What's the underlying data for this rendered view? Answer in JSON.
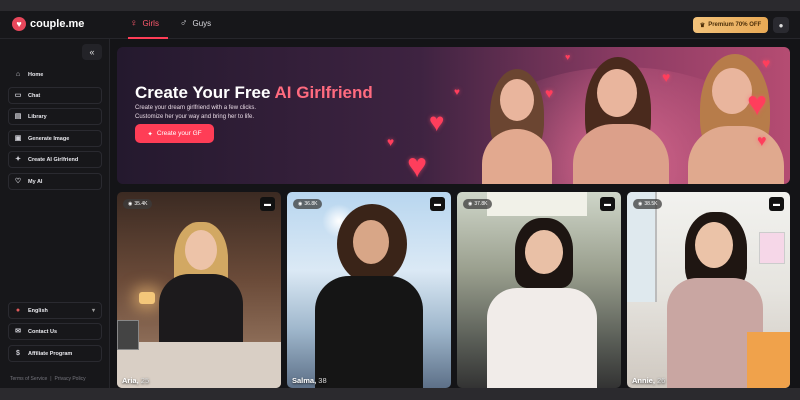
{
  "app": {
    "logo_text": "couple.me",
    "logo_icon": "heart-icon"
  },
  "header": {
    "tabs": [
      {
        "label": "Girls",
        "icon": "female-icon",
        "active": true
      },
      {
        "label": "Guys",
        "icon": "male-icon",
        "active": false
      }
    ],
    "premium_label": "Premium 70% OFF",
    "premium_icon": "crown-icon",
    "user_icon": "user-icon"
  },
  "sidebar": {
    "collapse_icon": "double-chevron-left-icon",
    "items": [
      {
        "label": "Home",
        "icon": "home-icon"
      },
      {
        "label": "Chat",
        "icon": "chat-icon"
      },
      {
        "label": "Library",
        "icon": "library-icon"
      },
      {
        "label": "Generate Image",
        "icon": "image-icon"
      },
      {
        "label": "Create AI Girlfriend",
        "icon": "sparkle-icon"
      },
      {
        "label": "My AI",
        "icon": "heart-icon"
      }
    ],
    "bottom_items": [
      {
        "label": "English",
        "icon": "flag-icon"
      },
      {
        "label": "Contact Us",
        "icon": "mail-icon"
      },
      {
        "label": "Affiliate Program",
        "icon": "dollar-icon"
      }
    ],
    "footer": {
      "terms": "Terms of Service",
      "separator": "|",
      "privacy": "Privacy Policy"
    }
  },
  "banner": {
    "title_prefix": "Create Your Free",
    "title_accent": "AI Girlfriend",
    "subtitle_line1": "Create your dream girlfriend with a few clicks.",
    "subtitle_line2": "Customize her your way and bring her to life.",
    "cta_label": "Create your GF",
    "cta_icon": "sparkle-icon"
  },
  "cards": [
    {
      "name": "Aria,",
      "age": "25",
      "views": "35.4K"
    },
    {
      "name": "Salma,",
      "age": "38",
      "views": "36.8K"
    },
    {
      "name": "",
      "age": "",
      "views": "37.8K"
    },
    {
      "name": "Annie,",
      "age": "26",
      "views": "38.5K"
    }
  ],
  "colors": {
    "accent": "#ff3d56",
    "premium": "#f2c27a",
    "background": "#141417"
  }
}
